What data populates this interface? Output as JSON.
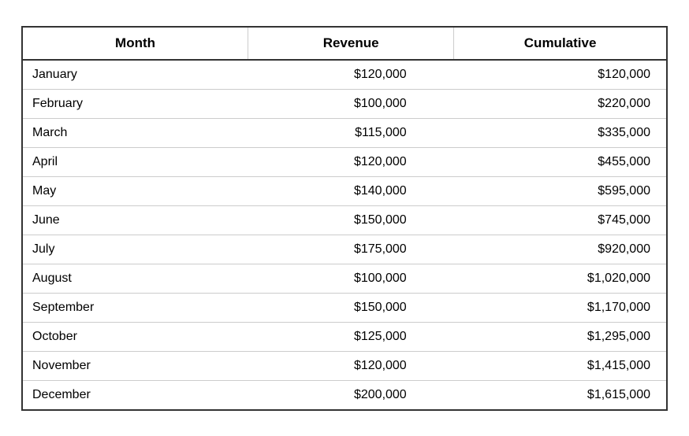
{
  "table": {
    "headers": {
      "month": "Month",
      "revenue": "Revenue",
      "cumulative": "Cumulative"
    },
    "rows": [
      {
        "month": "January",
        "revenue": "$120,000",
        "cumulative": "$120,000"
      },
      {
        "month": "February",
        "revenue": "$100,000",
        "cumulative": "$220,000"
      },
      {
        "month": "March",
        "revenue": "$115,000",
        "cumulative": "$335,000"
      },
      {
        "month": "April",
        "revenue": "$120,000",
        "cumulative": "$455,000"
      },
      {
        "month": "May",
        "revenue": "$140,000",
        "cumulative": "$595,000"
      },
      {
        "month": "June",
        "revenue": "$150,000",
        "cumulative": "$745,000"
      },
      {
        "month": "July",
        "revenue": "$175,000",
        "cumulative": "$920,000"
      },
      {
        "month": "August",
        "revenue": "$100,000",
        "cumulative": "$1,020,000"
      },
      {
        "month": "September",
        "revenue": "$150,000",
        "cumulative": "$1,170,000"
      },
      {
        "month": "October",
        "revenue": "$125,000",
        "cumulative": "$1,295,000"
      },
      {
        "month": "November",
        "revenue": "$120,000",
        "cumulative": "$1,415,000"
      },
      {
        "month": "December",
        "revenue": "$200,000",
        "cumulative": "$1,615,000"
      }
    ]
  }
}
